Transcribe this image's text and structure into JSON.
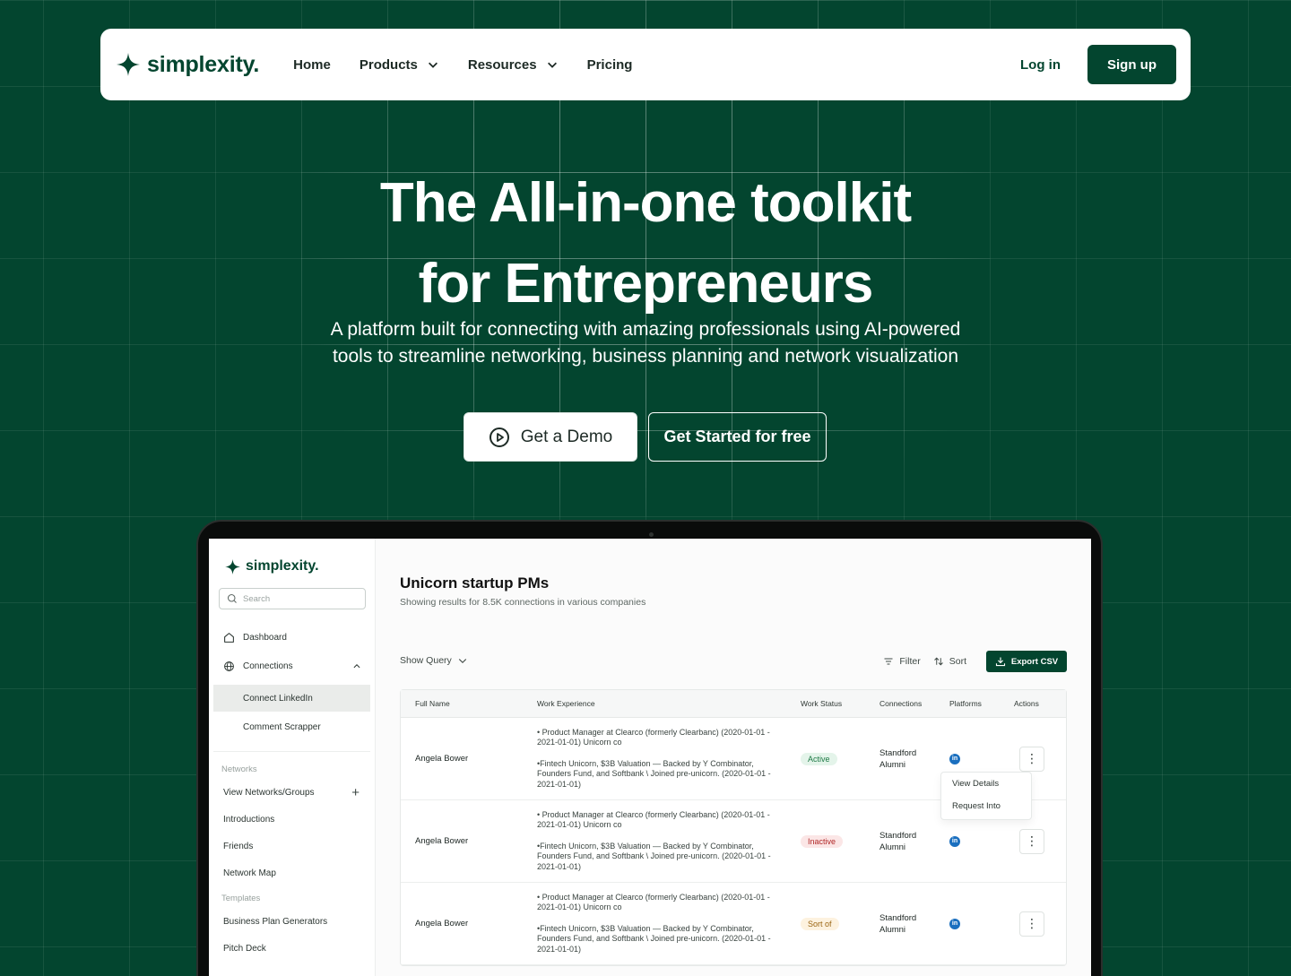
{
  "nav": {
    "brand": "simplexity.",
    "links": [
      {
        "label": "Home",
        "has_caret": false
      },
      {
        "label": "Products",
        "has_caret": true
      },
      {
        "label": "Resources",
        "has_caret": true
      },
      {
        "label": "Pricing",
        "has_caret": false
      }
    ],
    "login": "Log in",
    "signup": "Sign up"
  },
  "hero": {
    "title_line1": "The All-in-one toolkit",
    "title_line2": "for Entrepreneurs",
    "subtitle_line1": "A platform built for connecting with amazing professionals using AI-powered",
    "subtitle_line2": "tools to streamline networking, business planning and network visualization",
    "cta_demo": "Get a Demo",
    "cta_free": "Get Started for free"
  },
  "app": {
    "brand": "simplexity.",
    "search_placeholder": "Search",
    "sidebar": {
      "dashboard": "Dashboard",
      "connections": "Connections",
      "connections_sub": [
        "Connect LinkedIn",
        "Comment Scrapper"
      ],
      "networks_section": "Networks",
      "networks": [
        "View Networks/Groups",
        "Introductions",
        "Friends",
        "Network Map"
      ],
      "templates_section": "Templates",
      "templates": [
        "Business Plan Generators",
        "Pitch Deck"
      ]
    },
    "page_title": "Unicorn startup PMs",
    "page_subtitle": "Showing results for 8.5K connections in various companies",
    "show_query": "Show Query",
    "filter": "Filter",
    "sort": "Sort",
    "export": "Export CSV",
    "table": {
      "headers": [
        "Full Name",
        "Work Experience",
        "Work Status",
        "Connections",
        "Platforms",
        "Actions"
      ],
      "rows": [
        {
          "name": "Angela Bower",
          "exp1": "• Product Manager at Clearco (formerly Clearbanc) (2020-01-01 - 2021-01-01) Unicorn co",
          "exp2": "•Fintech Unicorn, $3B Valuation — Backed by Y Combinator, Founders Fund, and Softbank \\ Joined pre-unicorn. (2020-01-01 - 2021-01-01)",
          "status": "Active",
          "conn_line1": "Standford",
          "conn_line2": "Alumni"
        },
        {
          "name": "Angela Bower",
          "exp1": "• Product Manager at Clearco (formerly Clearbanc) (2020-01-01 - 2021-01-01) Unicorn co",
          "exp2": "•Fintech Unicorn, $3B Valuation — Backed by Y Combinator, Founders Fund, and Softbank \\ Joined pre-unicorn. (2020-01-01 - 2021-01-01)",
          "status": "Inactive",
          "conn_line1": "Standford",
          "conn_line2": "Alumni"
        },
        {
          "name": "Angela Bower",
          "exp1": "• Product Manager at Clearco (formerly Clearbanc) (2020-01-01 - 2021-01-01) Unicorn co",
          "exp2": "•Fintech Unicorn, $3B Valuation — Backed by Y Combinator, Founders Fund, and Softbank \\ Joined pre-unicorn. (2020-01-01 - 2021-01-01)",
          "status": "Sort of",
          "conn_line1": "Standford",
          "conn_line2": "Alumni"
        }
      ]
    },
    "action_menu": [
      "View Details",
      "Request Into"
    ]
  },
  "colors": {
    "brand_green": "#03452f",
    "background": "#03452f",
    "linkedin_blue": "#1a6fbf"
  },
  "icons": [
    "sparkle-star-icon",
    "chevron-down-icon",
    "play-circle-icon",
    "search-icon",
    "home-icon",
    "globe-icon",
    "chevron-up-icon",
    "plus-icon",
    "filter-icon",
    "sort-icon",
    "download-icon",
    "linkedin-icon",
    "kebab-icon"
  ]
}
